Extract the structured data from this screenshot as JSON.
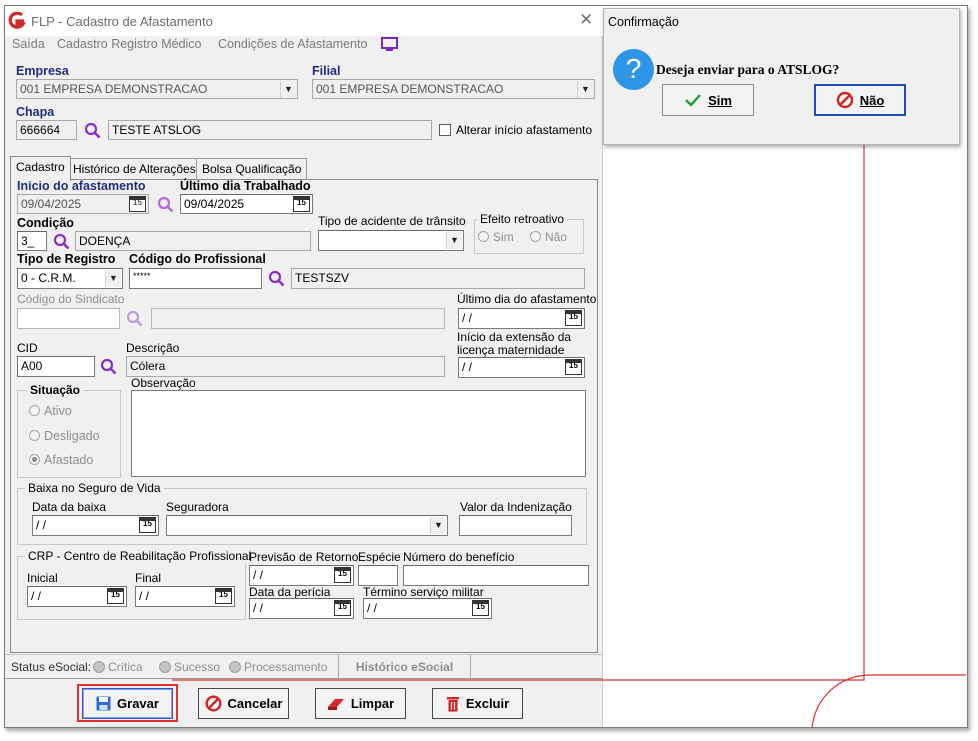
{
  "window": {
    "app_title": "FLP - Cadastro de Afastamento"
  },
  "menu": [
    "Saída",
    "Cadastro Registro Médico",
    "Condições de Afastamento"
  ],
  "header": {
    "empresa_label": "Empresa",
    "empresa_value": "001 EMPRESA DEMONSTRACAO",
    "filial_label": "Filial",
    "filial_value": "001 EMPRESA DEMONSTRACAO",
    "chapa_label": "Chapa",
    "chapa_value": "666664",
    "chapa_name": "TESTE ATSLOG",
    "alterar_label": "Alterar início afastamento"
  },
  "tabs": [
    "Cadastro",
    "Histórico de Alterações",
    "Bolsa Qualificação"
  ],
  "form": {
    "inicio_label": "Início do afastamento",
    "inicio_value": "09/04/2025",
    "ultimo_trab_label": "Último dia Trabalhado",
    "ultimo_trab_value": "09/04/2025",
    "condicao_label": "Condição",
    "condicao_code": "3_",
    "condicao_desc": "DOENÇA",
    "acidente_label": "Tipo de acidente de trânsito",
    "efeito_label": "Efeito retroativo",
    "efeito_sim": "Sim",
    "efeito_nao": "Não",
    "tipo_reg_label": "Tipo de Registro",
    "tipo_reg_value": "0  - C.R.M.",
    "cod_prof_label": "Código do Profissional",
    "cod_prof_value": "*****",
    "cod_prof_name": "TESTSZV",
    "cod_sind_label": "Código do Sindicato",
    "ultimo_afast_label": "Último dia do afastamento",
    "ultimo_afast_value": " / /",
    "cid_label": "CID",
    "cid_value": "A00",
    "descricao_label": "Descrição",
    "descricao_value": "Cólera",
    "ext_lic_label_1": "Início da extensão da",
    "ext_lic_label_2": "licença maternidade",
    "ext_lic_value": " / /",
    "situacao_label": "Situação",
    "sit_ativo": "Ativo",
    "sit_desligado": "Desligado",
    "sit_afastado": "Afastado",
    "observacao_label": "Observação",
    "baixa_group": "Baixa no Seguro de Vida",
    "data_baixa_label": "Data da baixa",
    "data_baixa_value": " / /",
    "seguradora_label": "Seguradora",
    "valor_ind_label": "Valor da Indenização",
    "crp_group": "CRP - Centro de Reabilitação Profissional",
    "inicial_label": "Inicial",
    "inicial_value": " / /",
    "final_label": "Final",
    "final_value": " / /",
    "prev_retorno_label": "Previsão de Retorno",
    "prev_retorno_value": " / /",
    "especie_label": "Espécie",
    "num_beneficio_label": "Número do benefício",
    "data_pericia_label": "Data da perícia",
    "data_pericia_value": " / /",
    "termino_label": "Término serviço militar",
    "termino_value": " / /"
  },
  "status": {
    "label": "Status eSocial:",
    "critica": "Crítica",
    "sucesso": "Sucesso",
    "processamento": "Processamento",
    "historico_button": "Histórico eSocial"
  },
  "buttons": {
    "gravar": "Gravar",
    "cancelar": "Cancelar",
    "limpar": "Limpar",
    "excluir": "Excluir"
  },
  "dialog": {
    "title": "Confirmação",
    "message": "Deseja enviar para o ATSLOG?",
    "sim": "Sim",
    "nao": "Não"
  },
  "colors": {
    "accent_blue": "#1f2d86",
    "highlight_red": "#e03030",
    "search_purple": "#8b2fc9"
  }
}
